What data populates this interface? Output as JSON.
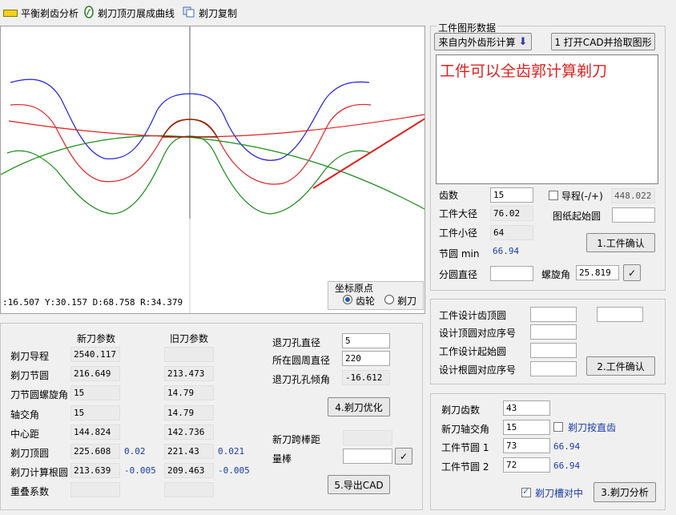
{
  "toolbar": {
    "items": [
      {
        "label": "平衡剃齿分析",
        "icon": "yellow-bar-icon"
      },
      {
        "label": "剃刀顶刃展成曲线",
        "icon": "curve-icon"
      },
      {
        "label": "剃刀复制",
        "icon": "copy-icon"
      }
    ]
  },
  "plot": {
    "status": ":16.507   Y:30.157   D:68.758   R:34.379",
    "origin_group_label": "坐标原点",
    "origin_gear_label": "齿轮",
    "origin_cutter_label": "剃刀",
    "origin_selected": "齿轮"
  },
  "workpiece_shape": {
    "title": "工件图形数据",
    "btn_calc": "来自内外齿形计算",
    "btn_open_cad": "1 打开CAD并拾取图形",
    "annotation": "工件可以全齿郭计算剃刀",
    "teeth_label": "齿数",
    "teeth_value": "15",
    "lead_label": "导程(-/+)",
    "lead_value": "448.022",
    "major_label": "工件大径",
    "major_value": "76.02",
    "drawing_start_label": "图纸起始圆",
    "drawing_start_value": "",
    "minor_label": "工件小径",
    "minor_value": "64",
    "pitch_label": "节圆 min",
    "pitch_value": "66.94",
    "confirm1": "1.工件确认",
    "ref_dia_label": "分圆直径",
    "ref_dia_value": "",
    "helix_label": "螺旋角",
    "helix_value": "25.819",
    "check_icon": "checkmark-icon"
  },
  "design": {
    "tip_circle_label": "工件设计齿顶圆",
    "tip_seq_label": "设计顶圆对应序号",
    "start_circle_label": "工作设计起始圆",
    "root_seq_label": "设计根圆对应序号",
    "confirm2": "2.工件确认"
  },
  "shaving": {
    "teeth_label": "剃刀齿数",
    "teeth_value": "43",
    "axis_label": "新刀轴交角",
    "axis_value": "15",
    "straight_label": "剃刀按直齿",
    "pitch1_label": "工件节圆 1",
    "pitch1_value": "73",
    "pitch1_extra": "66.94",
    "pitch2_label": "工件节圆 2",
    "pitch2_value": "72",
    "pitch2_extra": "66.94",
    "center_label": "剃刀槽对中",
    "analysis": "3.剃刀分析"
  },
  "params": {
    "new_header": "新刀参数",
    "old_header": "旧刀参数",
    "rows": [
      {
        "label": "剃刀导程",
        "new": "2540.117",
        "old": "",
        "new_d": "",
        "old_d": ""
      },
      {
        "label": "剃刀节圆",
        "new": "216.649",
        "old": "213.473",
        "new_d": "",
        "old_d": ""
      },
      {
        "label": "刀节圆螺旋角",
        "new": "15",
        "old": "14.79",
        "new_d": "",
        "old_d": ""
      },
      {
        "label": "轴交角",
        "new": "15",
        "old": "14.79",
        "new_d": "",
        "old_d": ""
      },
      {
        "label": "中心距",
        "new": "144.824",
        "old": "142.736",
        "new_d": "",
        "old_d": ""
      },
      {
        "label": "剃刀顶圆",
        "new": "225.608",
        "old": "221.43",
        "new_d": "0.02",
        "old_d": "0.021"
      },
      {
        "label": "剃刀计算根圆",
        "new": "213.639",
        "old": "209.463",
        "new_d": "-0.005",
        "old_d": "-0.005"
      },
      {
        "label": "重叠系数",
        "new": "",
        "old": "",
        "new_d": "",
        "old_d": ""
      }
    ],
    "hole_dia_label": "退刀孔直径",
    "hole_dia_value": "5",
    "hole_circle_label": "所在圆周直径",
    "hole_circle_value": "220",
    "hole_angle_label": "退刀孔孔倾角",
    "hole_angle_value": "-16.612",
    "optimize": "4.剃刀优化",
    "span_label": "新刀跨棒距",
    "span_value": "",
    "pin_label": "量棒",
    "pin_value": "",
    "export": "5.导出CAD"
  },
  "colors": {
    "blue_curve": "#2020e0",
    "red_curve": "#e02020",
    "green_curve": "#1a8a1a",
    "brown_curve": "#8b2500",
    "annotation": "#e02020"
  }
}
